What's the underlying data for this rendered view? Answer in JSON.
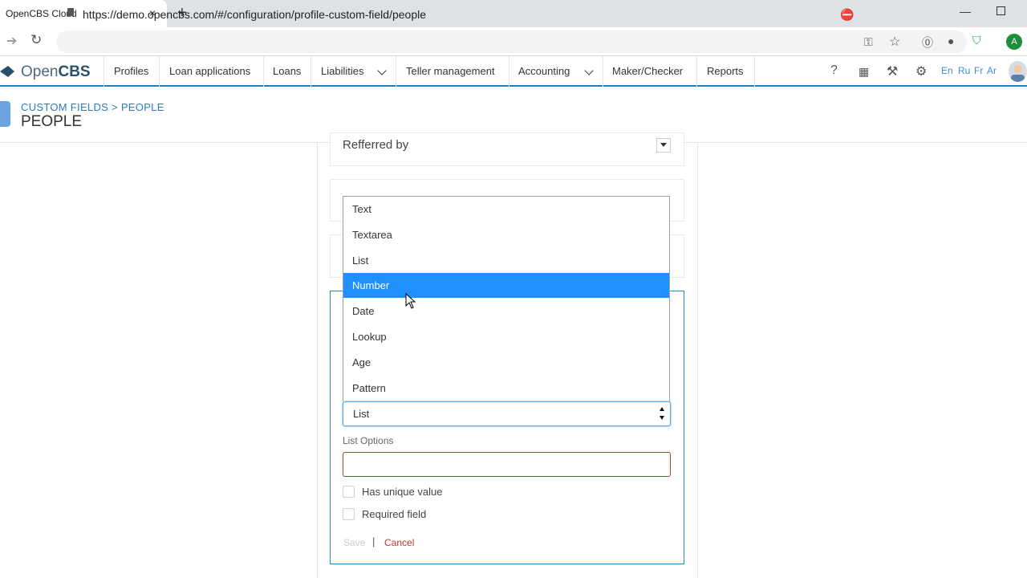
{
  "browser": {
    "tab_title": "OpenCBS Cloud",
    "tab_close": "×",
    "new_tab": "+",
    "url": "https://demo.opencbs.com/#/configuration/profile-custom-field/people",
    "profile_initial": "A",
    "window_minimize": "—"
  },
  "app": {
    "logo_open": "Open",
    "logo_cbs": "CBS",
    "nav": {
      "profiles": "Profiles",
      "loan_applications": "Loan applications",
      "loans": "Loans",
      "liabilities": "Liabilities",
      "teller_management": "Teller management",
      "accounting": "Accounting",
      "maker_checker": "Maker/Checker",
      "reports": "Reports"
    },
    "help": "?",
    "languages": {
      "en": "En",
      "ru": "Ru",
      "fr": "Fr",
      "ar": "Ar"
    }
  },
  "page": {
    "breadcrumb": "CUSTOM FIELDS > PEOPLE",
    "title": "PEOPLE"
  },
  "cards": {
    "referred_by": "Refferred by"
  },
  "field_type_select": {
    "value": "List",
    "options": [
      "Text",
      "Textarea",
      "List",
      "Number",
      "Date",
      "Lookup",
      "Age",
      "Pattern"
    ],
    "highlighted": "Number"
  },
  "form": {
    "list_options_label": "List Options",
    "list_options_value": "",
    "has_unique_value": "Has unique value",
    "required_field": "Required field",
    "save": "Save",
    "separator": "|",
    "cancel": "Cancel"
  },
  "colors": {
    "accent": "#1a83c4",
    "highlight": "#1e90ff",
    "error": "#c0392b"
  }
}
